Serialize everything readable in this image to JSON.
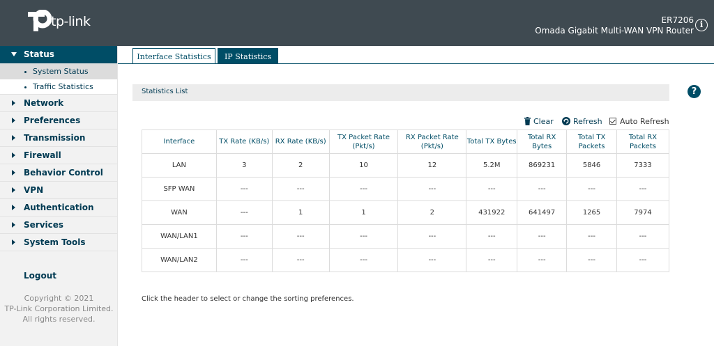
{
  "header": {
    "logo_text": "tp-link",
    "model": "ER7206",
    "device_desc": "Omada Gigabit Multi-WAN VPN Router",
    "info_icon": "info-icon"
  },
  "sidebar": {
    "items": [
      {
        "label": "Status",
        "active": true,
        "subitems": [
          {
            "label": "System Status",
            "selected": true
          },
          {
            "label": "Traffic Statistics",
            "selected": false
          }
        ]
      },
      {
        "label": "Network"
      },
      {
        "label": "Preferences"
      },
      {
        "label": "Transmission"
      },
      {
        "label": "Firewall"
      },
      {
        "label": "Behavior Control"
      },
      {
        "label": "VPN"
      },
      {
        "label": "Authentication"
      },
      {
        "label": "Services"
      },
      {
        "label": "System Tools"
      }
    ],
    "logout": "Logout",
    "copyright": [
      "Copyright © 2021",
      "TP-Link Corporation Limited.",
      "All rights reserved."
    ]
  },
  "tabs": [
    {
      "label": "Interface Statistics",
      "active": true
    },
    {
      "label": "IP Statistics",
      "active": false
    }
  ],
  "section": {
    "title": "Statistics List"
  },
  "toolbar": {
    "clear_label": "Clear",
    "refresh_label": "Refresh",
    "auto_refresh_label": "Auto Refresh",
    "auto_refresh_checked": true
  },
  "table": {
    "headers": [
      "Interface",
      "TX Rate (KB/s)",
      "RX Rate (KB/s)",
      "TX Packet Rate (Pkt/s)",
      "RX Packet Rate (Pkt/s)",
      "Total TX Bytes",
      "Total RX Bytes",
      "Total TX Packets",
      "Total RX Packets"
    ],
    "rows": [
      [
        "LAN",
        "3",
        "2",
        "10",
        "12",
        "5.2M",
        "869231",
        "5846",
        "7333"
      ],
      [
        "SFP WAN",
        "---",
        "---",
        "---",
        "---",
        "---",
        "---",
        "---",
        "---"
      ],
      [
        "WAN",
        "---",
        "1",
        "1",
        "2",
        "431922",
        "641497",
        "1265",
        "7974"
      ],
      [
        "WAN/LAN1",
        "---",
        "---",
        "---",
        "---",
        "---",
        "---",
        "---",
        "---"
      ],
      [
        "WAN/LAN2",
        "---",
        "---",
        "---",
        "---",
        "---",
        "---",
        "---",
        "---"
      ]
    ]
  },
  "hint": "Click the header to select or change the sorting preferences.",
  "colors": {
    "header_bg": "#3f4a51",
    "accent": "#004d66"
  }
}
